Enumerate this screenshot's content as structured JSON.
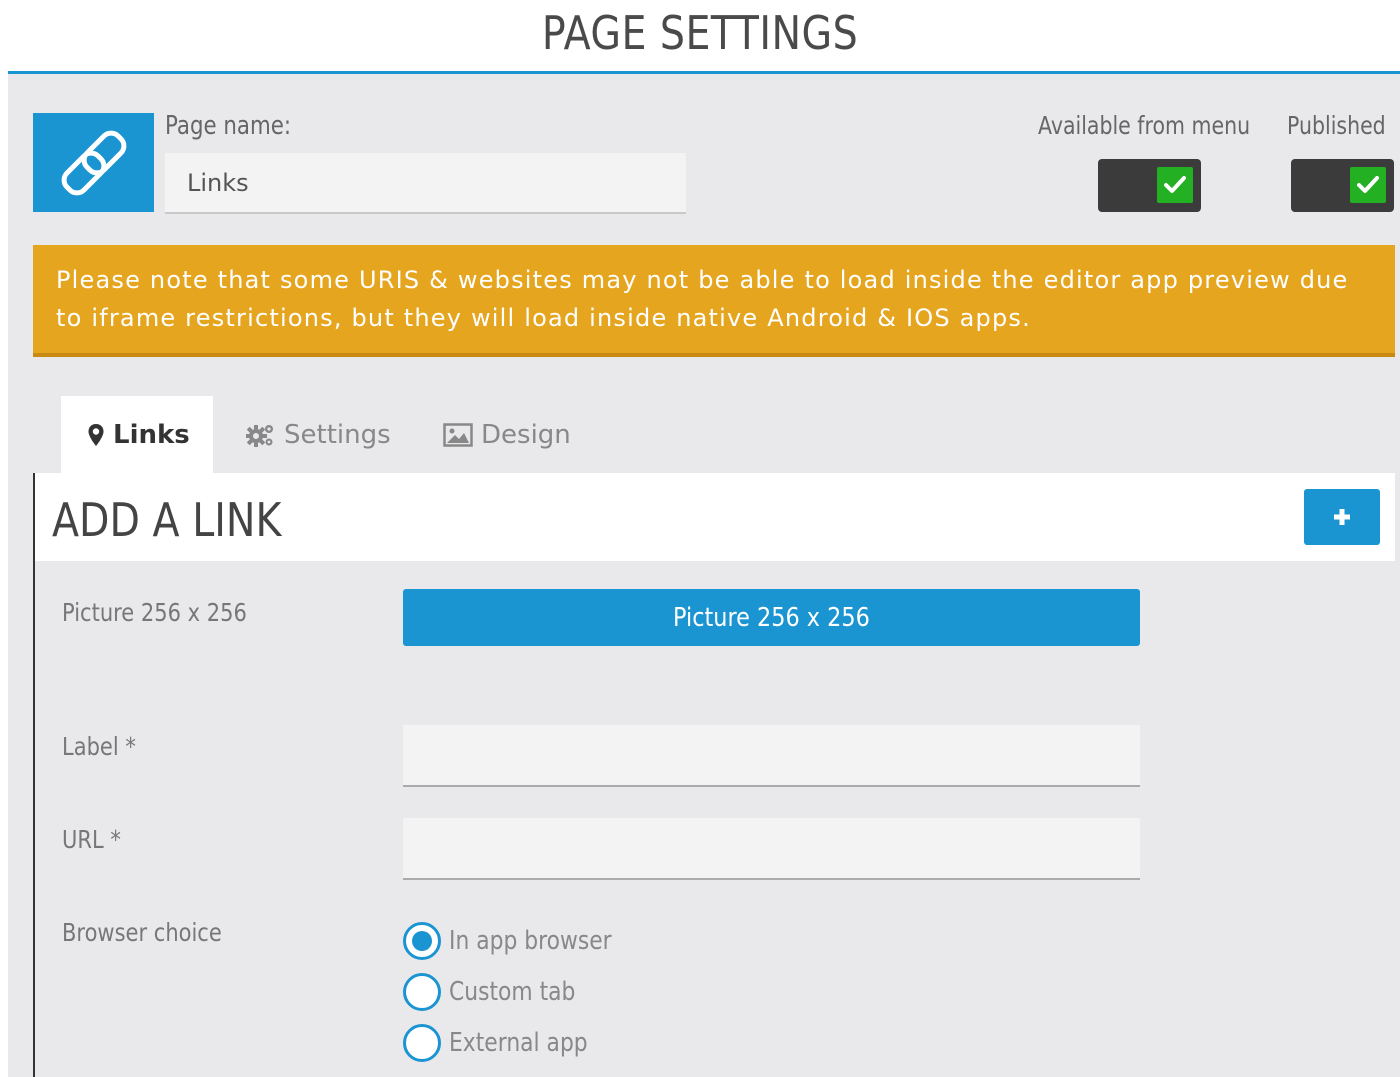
{
  "header": {
    "title": "PAGE SETTINGS"
  },
  "page": {
    "icon": "link-icon",
    "name_label": "Page name:",
    "name_value": "Links"
  },
  "toggles": [
    {
      "label": "Available from menu",
      "checked": true
    },
    {
      "label": "Published",
      "checked": true
    }
  ],
  "notice": {
    "text": "Please note that some URIS & websites may not be able to load inside the editor app preview due to iframe restrictions, but they will load inside native Android & IOS apps."
  },
  "tabs": [
    {
      "label": "Links",
      "icon": "map-marker-icon",
      "active": true
    },
    {
      "label": "Settings",
      "icon": "cogs-icon",
      "active": false
    },
    {
      "label": "Design",
      "icon": "picture-icon",
      "active": false
    }
  ],
  "form": {
    "title": "ADD A LINK",
    "add_button_icon": "plus-icon",
    "picture_label": "Picture 256 x 256",
    "picture_button": "Picture 256 x 256",
    "label_label": "Label *",
    "label_value": "",
    "url_label": "URL *",
    "url_value": "",
    "browser_label": "Browser choice",
    "browser_options": [
      {
        "label": "In app browser",
        "selected": true
      },
      {
        "label": "Custom tab",
        "selected": false
      },
      {
        "label": "External app",
        "selected": false
      }
    ]
  },
  "colors": {
    "accent": "#1b94d2",
    "warning": "#e6a51f",
    "toggle_bg": "#3b3b3b",
    "toggle_on": "#23b023"
  }
}
